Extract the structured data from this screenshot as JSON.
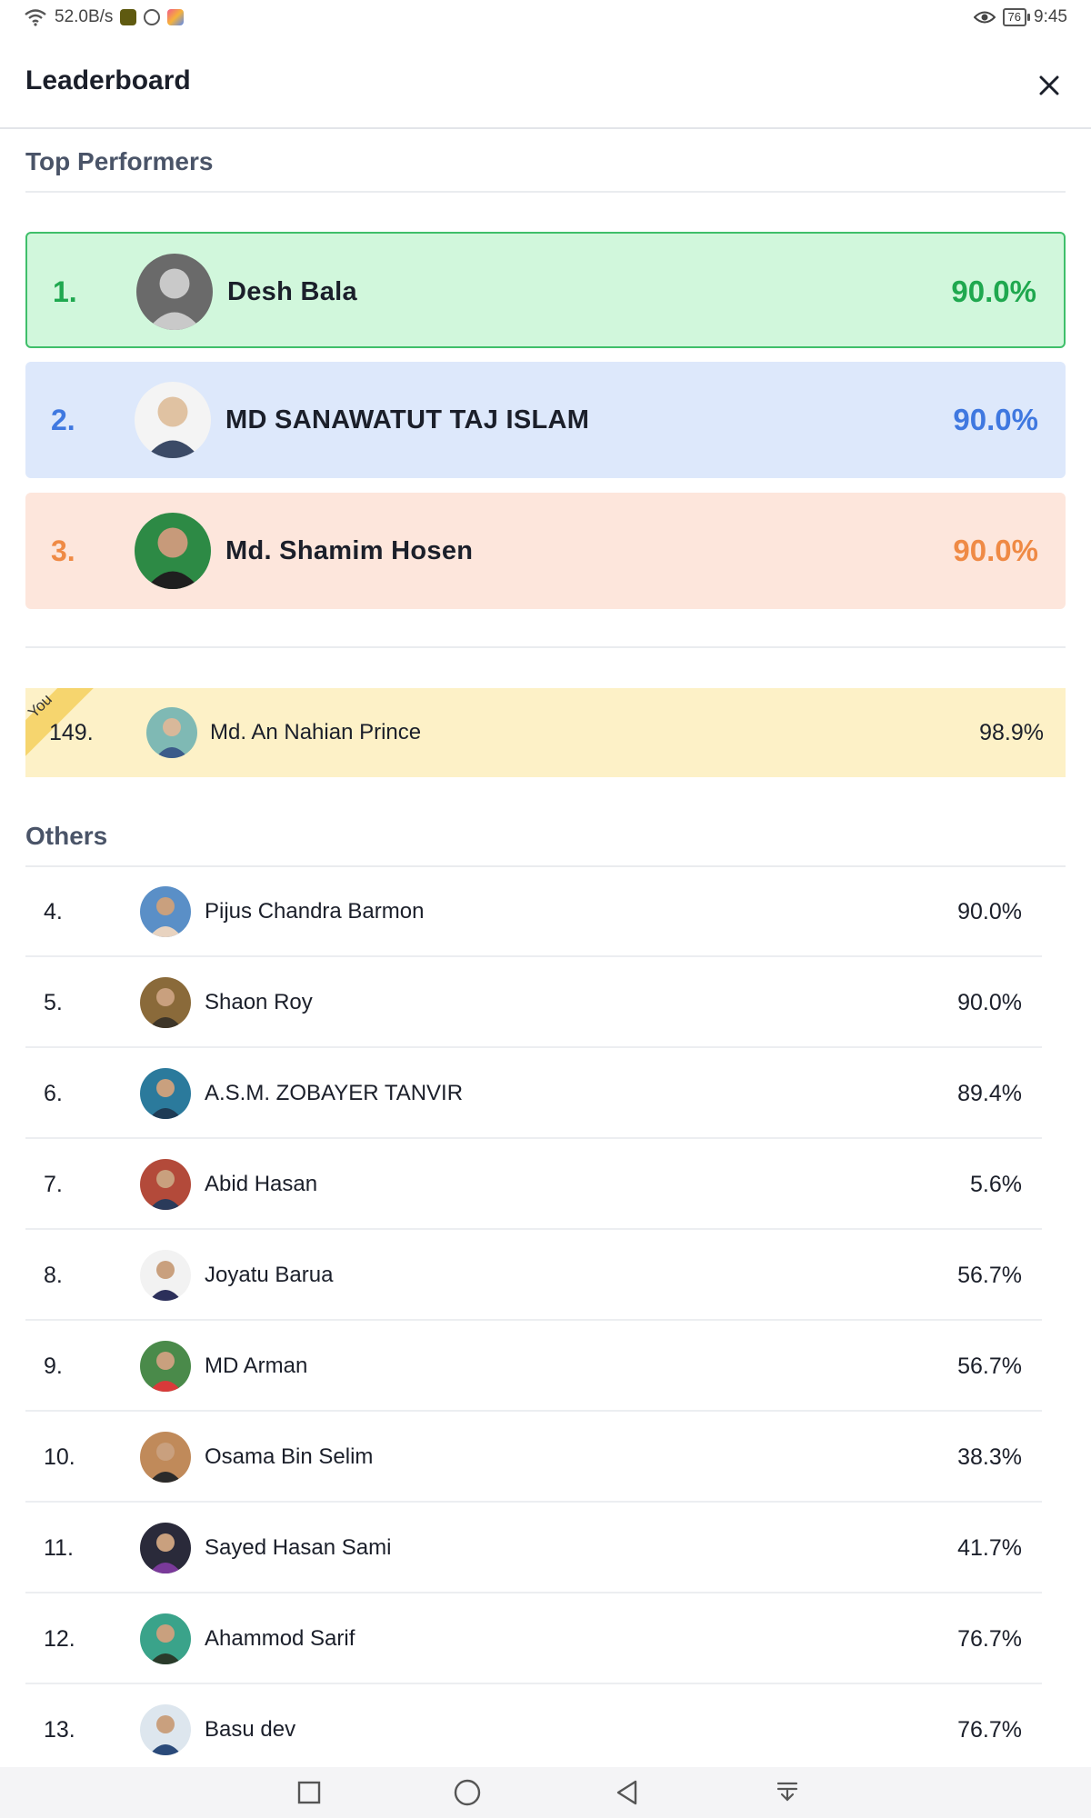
{
  "status_bar": {
    "network_speed": "52.0B/s",
    "battery": "76",
    "time": "9:45"
  },
  "header": {
    "title": "Leaderboard"
  },
  "top_performers": {
    "title": "Top Performers",
    "items": [
      {
        "rank": "1.",
        "name": "Desh Bala",
        "score": "90.0%",
        "avatar_colors": [
          "#6a6a6a",
          "#c9c9c9"
        ]
      },
      {
        "rank": "2.",
        "name": "MD SANAWATUT TAJ ISLAM",
        "score": "90.0%",
        "avatar_colors": [
          "#3b4a66",
          "#e0c2a2"
        ]
      },
      {
        "rank": "3.",
        "name": "Md. Shamim Hosen",
        "score": "90.0%",
        "avatar_colors": [
          "#2d8a45",
          "#1f1f1f"
        ]
      }
    ]
  },
  "you": {
    "badge": "You",
    "rank": "149.",
    "name": "Md. An Nahian Prince",
    "score": "98.9%",
    "avatar_colors": [
      "#7fb9b4",
      "#3b5b8a"
    ]
  },
  "others": {
    "title": "Others",
    "items": [
      {
        "rank": "4.",
        "name": "Pijus Chandra Barmon",
        "score": "90.0%",
        "avatar_colors": [
          "#5a8fc7",
          "#e8d3c0"
        ]
      },
      {
        "rank": "5.",
        "name": "Shaon Roy",
        "score": "90.0%",
        "avatar_colors": [
          "#8a6a3a",
          "#3d3528"
        ]
      },
      {
        "rank": "6.",
        "name": "A.S.M. ZOBAYER TANVIR",
        "score": "89.4%",
        "avatar_colors": [
          "#2b7a9c",
          "#1e3b55"
        ]
      },
      {
        "rank": "7.",
        "name": "Abid Hasan",
        "score": "5.6%",
        "avatar_colors": [
          "#b34a3a",
          "#2a3a5a"
        ]
      },
      {
        "rank": "8.",
        "name": "Joyatu Barua",
        "score": "56.7%",
        "avatar_colors": [
          "#f2f2f2",
          "#2b2f5a"
        ]
      },
      {
        "rank": "9.",
        "name": "MD Arman",
        "score": "56.7%",
        "avatar_colors": [
          "#4a8a4a",
          "#d93a3a"
        ]
      },
      {
        "rank": "10.",
        "name": "Osama Bin Selim",
        "score": "38.3%",
        "avatar_colors": [
          "#c08a5a",
          "#2a2a2a"
        ]
      },
      {
        "rank": "11.",
        "name": "Sayed Hasan Sami",
        "score": "41.7%",
        "avatar_colors": [
          "#2a2a3a",
          "#7a3a9a"
        ]
      },
      {
        "rank": "12.",
        "name": "Ahammod Sarif",
        "score": "76.7%",
        "avatar_colors": [
          "#3aa38a",
          "#2a3a2a"
        ]
      },
      {
        "rank": "13.",
        "name": "Basu dev",
        "score": "76.7%",
        "avatar_colors": [
          "#dde6ee",
          "#2a4a7a"
        ]
      }
    ]
  }
}
